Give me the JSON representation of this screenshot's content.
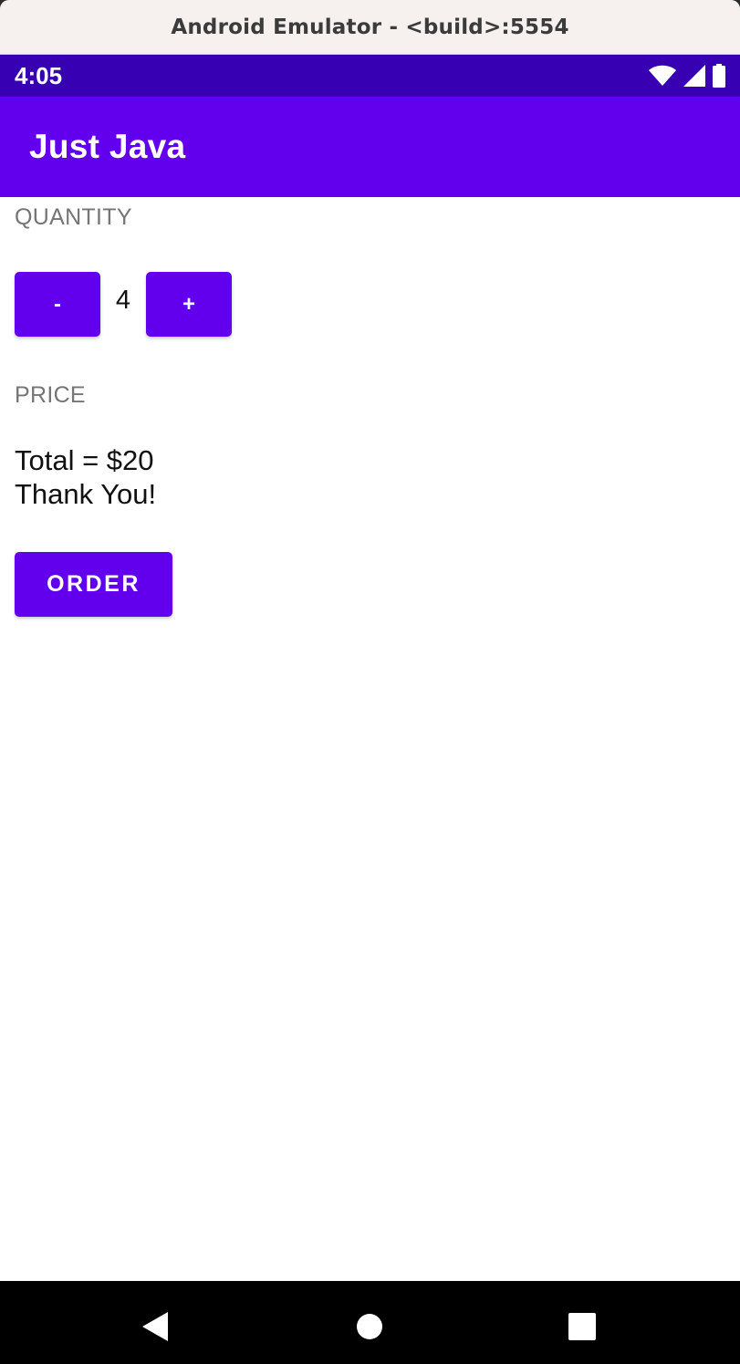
{
  "window": {
    "title": "Android Emulator - <build>:5554"
  },
  "status_bar": {
    "time": "4:05",
    "icons": [
      "wifi-icon",
      "cellular-signal-icon",
      "battery-icon"
    ],
    "background": "#3700b3"
  },
  "app_bar": {
    "title": "Just Java",
    "background": "#6200ee"
  },
  "quantity": {
    "label": "QUANTITY",
    "decrement_label": "-",
    "value": "4",
    "increment_label": "+"
  },
  "price": {
    "label": "PRICE",
    "summary_line1": "Total = $20",
    "summary_line2": "Thank You!"
  },
  "order_button": {
    "label": "ORDER"
  },
  "nav_bar": {
    "icons": [
      "back-icon",
      "home-icon",
      "recents-icon"
    ]
  },
  "colors": {
    "accent": "#6200ee",
    "primary_dark": "#3700b3",
    "label_gray": "#757575"
  }
}
